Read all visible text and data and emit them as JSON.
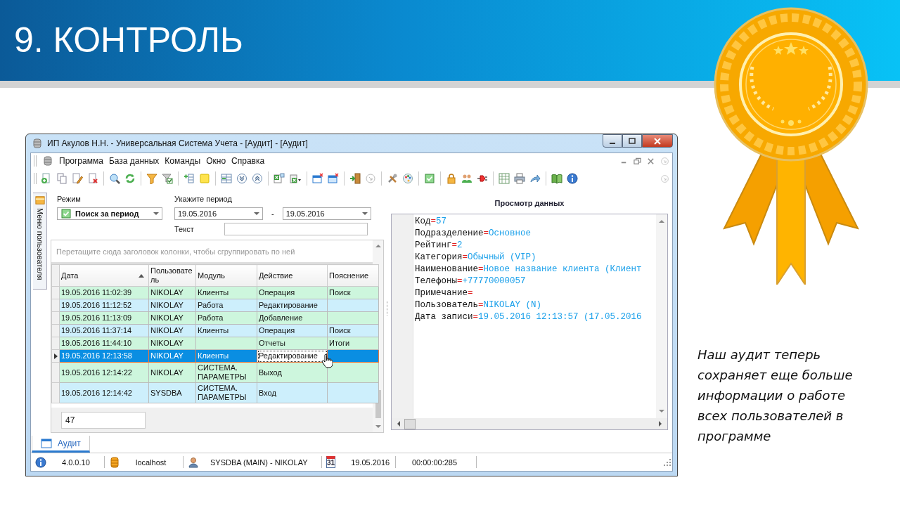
{
  "slide": {
    "title": "9. КОНТРОЛЬ",
    "caption": "Наш аудит теперь сохраняет еще больше информации о работе всех пользователей в программе"
  },
  "window": {
    "title": "ИП Акулов Н.Н. - Универсальная Система Учета - [Аудит] - [Аудит]"
  },
  "menu": [
    "Программа",
    "База данных",
    "Команды",
    "Окно",
    "Справка"
  ],
  "side_tab": {
    "label": "Меню пользователя"
  },
  "filter": {
    "mode_label": "Режим",
    "mode_value": "Поиск за период",
    "period_label": "Укажите период",
    "date_from": "19.05.2016",
    "dash": "-",
    "date_to": "19.05.2016",
    "text_label": "Текст"
  },
  "grid": {
    "group_hint": "Перетащите сюда заголовок колонки, чтобы сгруппировать по ней",
    "columns": [
      {
        "label": "Дата",
        "sorted": true
      },
      {
        "label": "Пользователь",
        "sorted": false
      },
      {
        "label": "Модуль",
        "sorted": false
      },
      {
        "label": "Действие",
        "sorted": false
      },
      {
        "label": "Пояснение",
        "sorted": false
      }
    ],
    "rows": [
      {
        "date": "19.05.2016 11:02:39",
        "user": "NIKOLAY",
        "module": "Клиенты",
        "action": "Операция",
        "note": "Поиск",
        "selected": false
      },
      {
        "date": "19.05.2016 11:12:52",
        "user": "NIKOLAY",
        "module": "Работа",
        "action": "Редактирование",
        "selected": false
      },
      {
        "date": "19.05.2016 11:13:09",
        "user": "NIKOLAY",
        "module": "Работа",
        "action": "Добавление",
        "selected": false
      },
      {
        "date": "19.05.2016 11:37:14",
        "user": "NIKOLAY",
        "module": "Клиенты",
        "action": "Операция",
        "note": "Поиск",
        "selected": false
      },
      {
        "date": "19.05.2016 11:44:10",
        "user": "NIKOLAY",
        "action": "Отчеты",
        "note": "Итоги",
        "selected": false
      },
      {
        "date": "19.05.2016 12:13:58",
        "user": "NIKOLAY",
        "module": "Клиенты",
        "action": "Редактирование",
        "selected": true
      },
      {
        "date": "19.05.2016 12:14:22",
        "user": "NIKOLAY",
        "module": "СИСТЕМА. ПАРАМЕТРЫ",
        "action": "Выход",
        "selected": false
      },
      {
        "date": "19.05.2016 12:14:42",
        "user": "SYSDBA",
        "module": "СИСТЕМА. ПАРАМЕТРЫ",
        "action": "Вход",
        "selected": false
      }
    ],
    "count": "47"
  },
  "viewer": {
    "title": "Просмотр данных",
    "lines": [
      {
        "key": "Код",
        "sep": "=",
        "value": "57"
      },
      {
        "key": "Подразделение",
        "sep": "=",
        "value": "Основное"
      },
      {
        "key": "Рейтинг",
        "sep": "=",
        "value": "2"
      },
      {
        "key": "Категория",
        "sep": "=",
        "value": "Обычный (VIP)"
      },
      {
        "key": "Наименование",
        "sep": "=",
        "value": "Новое название клиента (Клиент"
      },
      {
        "key": "Телефоны",
        "sep": "=",
        "value": "+77770000057"
      },
      {
        "key": "Примечание",
        "sep": "="
      },
      {
        "key": "Пользователь",
        "sep": "=",
        "value": "NIKOLAY (N)"
      },
      {
        "key": "Дата записи",
        "sep": "=",
        "value": "19.05.2016 12:13:57 (17.05.2016"
      }
    ]
  },
  "tabs": [
    {
      "label": "Аудит",
      "selected": true
    }
  ],
  "status_bar": {
    "version": "4.0.0.10",
    "host": "localhost",
    "user": "SYSDBA (MAIN) - NIKOLAY",
    "calendar_day": "31",
    "date": "19.05.2016",
    "elapsed": "00:00:00:285"
  }
}
